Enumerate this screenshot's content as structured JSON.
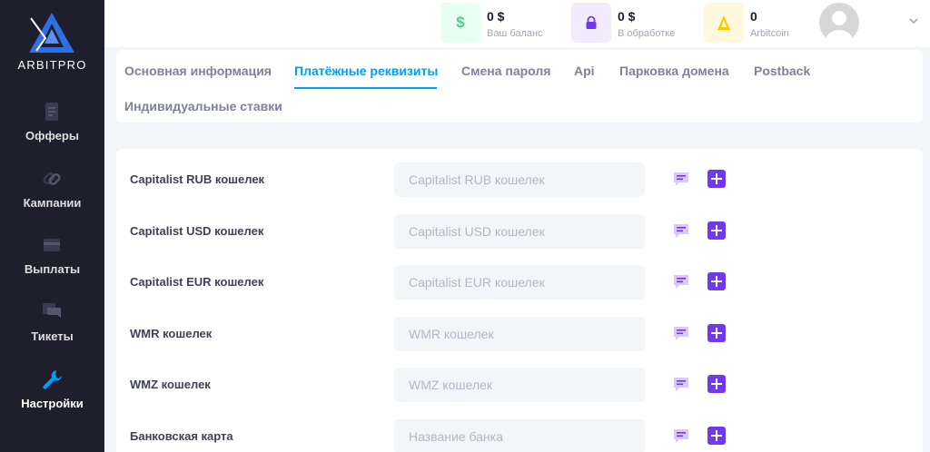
{
  "brand": {
    "name": "ARBITPRO",
    "accent": "#2f6fe4"
  },
  "sidebar": {
    "items": [
      {
        "label": "Офферы",
        "icon": "offers-icon",
        "active": false
      },
      {
        "label": "Кампании",
        "icon": "link-icon",
        "active": false
      },
      {
        "label": "Выплаты",
        "icon": "payouts-icon",
        "active": false
      },
      {
        "label": "Тикеты",
        "icon": "tickets-icon",
        "active": false
      },
      {
        "label": "Настройки",
        "icon": "wrench-icon",
        "active": true
      }
    ]
  },
  "header": {
    "balance": {
      "value": "0 $",
      "caption": "Ваш баланс",
      "icon": "dollar-icon",
      "color": "#50cd89"
    },
    "processing": {
      "value": "0 $",
      "caption": "В обработке",
      "icon": "lock-icon",
      "color": "#7239ea"
    },
    "arbitcoin": {
      "value": "0",
      "caption": "Arbitcoin",
      "icon": "coin-icon",
      "color": "#ffc700"
    },
    "avatar_icon": "user-avatar-icon",
    "menu_icon": "chevron-down-icon"
  },
  "tabs": [
    {
      "label": "Основная информация",
      "active": false
    },
    {
      "label": "Платёжные реквизиты",
      "active": true
    },
    {
      "label": "Смена пароля",
      "active": false
    },
    {
      "label": "Api",
      "active": false
    },
    {
      "label": "Парковка домена",
      "active": false
    },
    {
      "label": "Postback",
      "active": false
    },
    {
      "label": "Индивидуальные ставки",
      "active": false
    }
  ],
  "form": {
    "rows": [
      {
        "label": "Capitalist RUB кошелек",
        "value": "",
        "placeholder": "Capitalist RUB кошелек"
      },
      {
        "label": "Capitalist USD кошелек",
        "value": "",
        "placeholder": "Capitalist USD кошелек"
      },
      {
        "label": "Capitalist EUR кошелек",
        "value": "",
        "placeholder": "Capitalist EUR кошелек"
      },
      {
        "label": "WMR кошелек",
        "value": "",
        "placeholder": "WMR кошелек"
      },
      {
        "label": "WMZ кошелек",
        "value": "",
        "placeholder": "WMZ кошелек"
      },
      {
        "label": "Банковская карта",
        "value": "",
        "placeholder": "Название банка"
      }
    ],
    "comment_icon": "comment-icon",
    "add_icon": "plus-icon",
    "action_color": "#7239ea"
  }
}
